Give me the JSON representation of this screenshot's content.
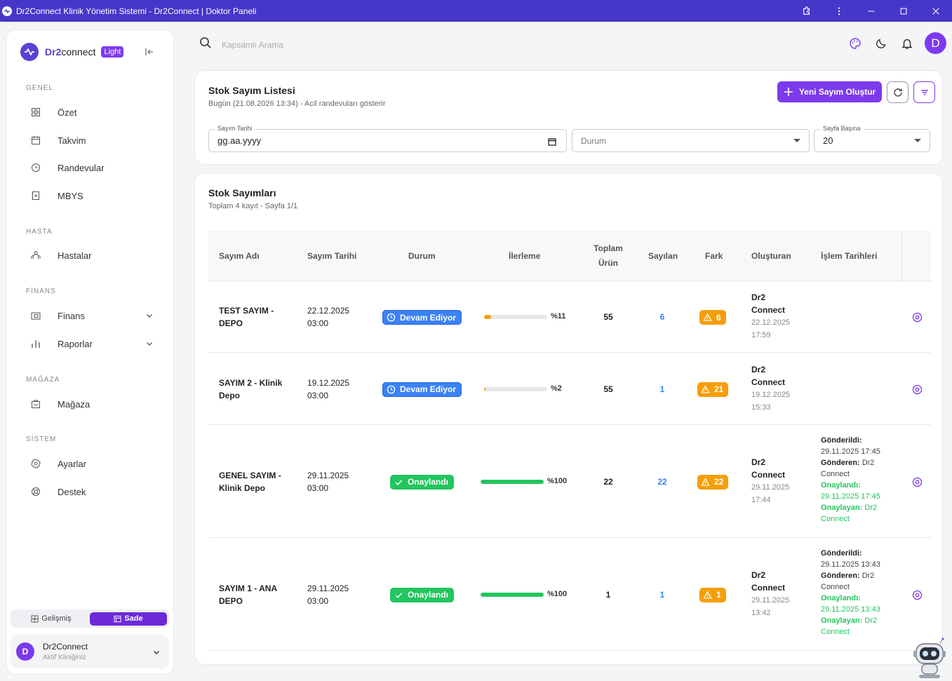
{
  "window": {
    "title": "Dr2Connect Klinik Yönetim Sistemi - Dr2Connect | Doktor Paneli"
  },
  "sidebar": {
    "brand_prefix": "Dr2",
    "brand_suffix": "connect",
    "theme_badge": "Light",
    "sections": {
      "genel": "GENEL",
      "hasta": "HASTA",
      "finans": "FİNANS",
      "magaza": "MAĞAZA",
      "sistem": "SİSTEM"
    },
    "items": {
      "ozet": "Özet",
      "takvim": "Takvim",
      "randevular": "Randevular",
      "mbys": "MBYS",
      "hastalar": "Hastalar",
      "finans": "Finans",
      "raporlar": "Raporlar",
      "magaza": "Mağaza",
      "ayarlar": "Ayarlar",
      "destek": "Destek"
    },
    "mode": {
      "advanced": "Gelişmiş",
      "simple": "Sade",
      "active": "simple"
    },
    "user": {
      "initial": "D",
      "name": "Dr2Connect",
      "subtitle": "Aktif Kliniğiniz"
    }
  },
  "topbar": {
    "search_placeholder": "Kapsamlı Arama",
    "avatar_initial": "D"
  },
  "list_card": {
    "title": "Stok Sayım Listesi",
    "subtitle": "Bugün (21.08.2026 13:34) - Acil randevuları gösterir",
    "new_button": "Yeni Sayım Oluştur",
    "filters": {
      "date_label": "Sayım Tarihi",
      "date_value": "gg.aa.yyyy",
      "status_placeholder": "Durum",
      "page_size_label": "Sayfa Başına",
      "page_size_value": "20"
    }
  },
  "counts_card": {
    "title": "Stok Sayımları",
    "subtitle": "Toplam 4 kayıt - Sayfa 1/1",
    "columns": {
      "name": "Sayım Adı",
      "date": "Sayım Tarihi",
      "status": "Durum",
      "progress": "İlerleme",
      "total_line1": "Toplam",
      "total_line2": "Ürün",
      "counted": "Sayılan",
      "diff": "Fark",
      "creator": "Oluşturan",
      "dates": "İşlem Tarihleri"
    },
    "rows": [
      {
        "name_l1": "TEST SAYIM -",
        "name_l2": "DEPO",
        "date_l1": "22.12.2025",
        "date_l2": "03:00",
        "status": "Devam Ediyor",
        "status_kind": "blue",
        "progress": 11,
        "progress_label": "%11",
        "total": "55",
        "counted": "6",
        "diff": "6",
        "creator_l1": "Dr2",
        "creator_l2": "Connect",
        "created_l1": "22.12.2025",
        "created_l2": "17:59"
      },
      {
        "name_l1": "SAYIM 2 - Klinik",
        "name_l2": "Depo",
        "date_l1": "19.12.2025",
        "date_l2": "03:00",
        "status": "Devam Ediyor",
        "status_kind": "blue",
        "progress": 2,
        "progress_label": "%2",
        "total": "55",
        "counted": "1",
        "diff": "21",
        "creator_l1": "Dr2",
        "creator_l2": "Connect",
        "created_l1": "19.12.2025",
        "created_l2": "15:33"
      },
      {
        "name_l1": "GENEL SAYIM -",
        "name_l2": "Klinik Depo",
        "date_l1": "29.11.2025",
        "date_l2": "03:00",
        "status": "Onaylandı",
        "status_kind": "green",
        "progress": 100,
        "progress_label": "%100",
        "total": "22",
        "counted": "22",
        "diff": "22",
        "creator_l1": "Dr2",
        "creator_l2": "Connect",
        "created_l1": "29.11.2025",
        "created_l2": "17:44",
        "sent_label": "Gönderildi:",
        "sent_at": "29.11.2025 17:45",
        "sender_label": "Gönderen:",
        "sender_l1": "Dr2",
        "sender_l2": "Connect",
        "approved_label": "Onaylandı:",
        "approved_at": "29.11.2025 17:45",
        "approver_label": "Onaylayan:",
        "approver_l1": "Dr2",
        "approver_l2": "Connect"
      },
      {
        "name_l1": "SAYIM 1 - ANA",
        "name_l2": "DEPO",
        "date_l1": "29.11.2025",
        "date_l2": "03:00",
        "status": "Onaylandı",
        "status_kind": "green",
        "progress": 100,
        "progress_label": "%100",
        "total": "1",
        "counted": "1",
        "diff": "1",
        "creator_l1": "Dr2",
        "creator_l2": "Connect",
        "created_l1": "29.11.2025",
        "created_l2": "13:42",
        "sent_label": "Gönderildi:",
        "sent_at": "29.11.2025 13:43",
        "sender_label": "Gönderen:",
        "sender_l1": "Dr2",
        "sender_l2": "Connect",
        "approved_label": "Onaylandı:",
        "approved_at": "29.11.2025 13:43",
        "approver_label": "Onaylayan:",
        "approver_l1": "Dr2",
        "approver_l2": "Connect"
      }
    ]
  },
  "colors": {
    "titlebar": "#4637c9",
    "accent": "#7c3aed",
    "status_blue": "#3b82f6",
    "status_green": "#22c55e",
    "warning": "#f59e0b",
    "progress_low": "#f59e0b",
    "progress_done": "#22c55e"
  }
}
